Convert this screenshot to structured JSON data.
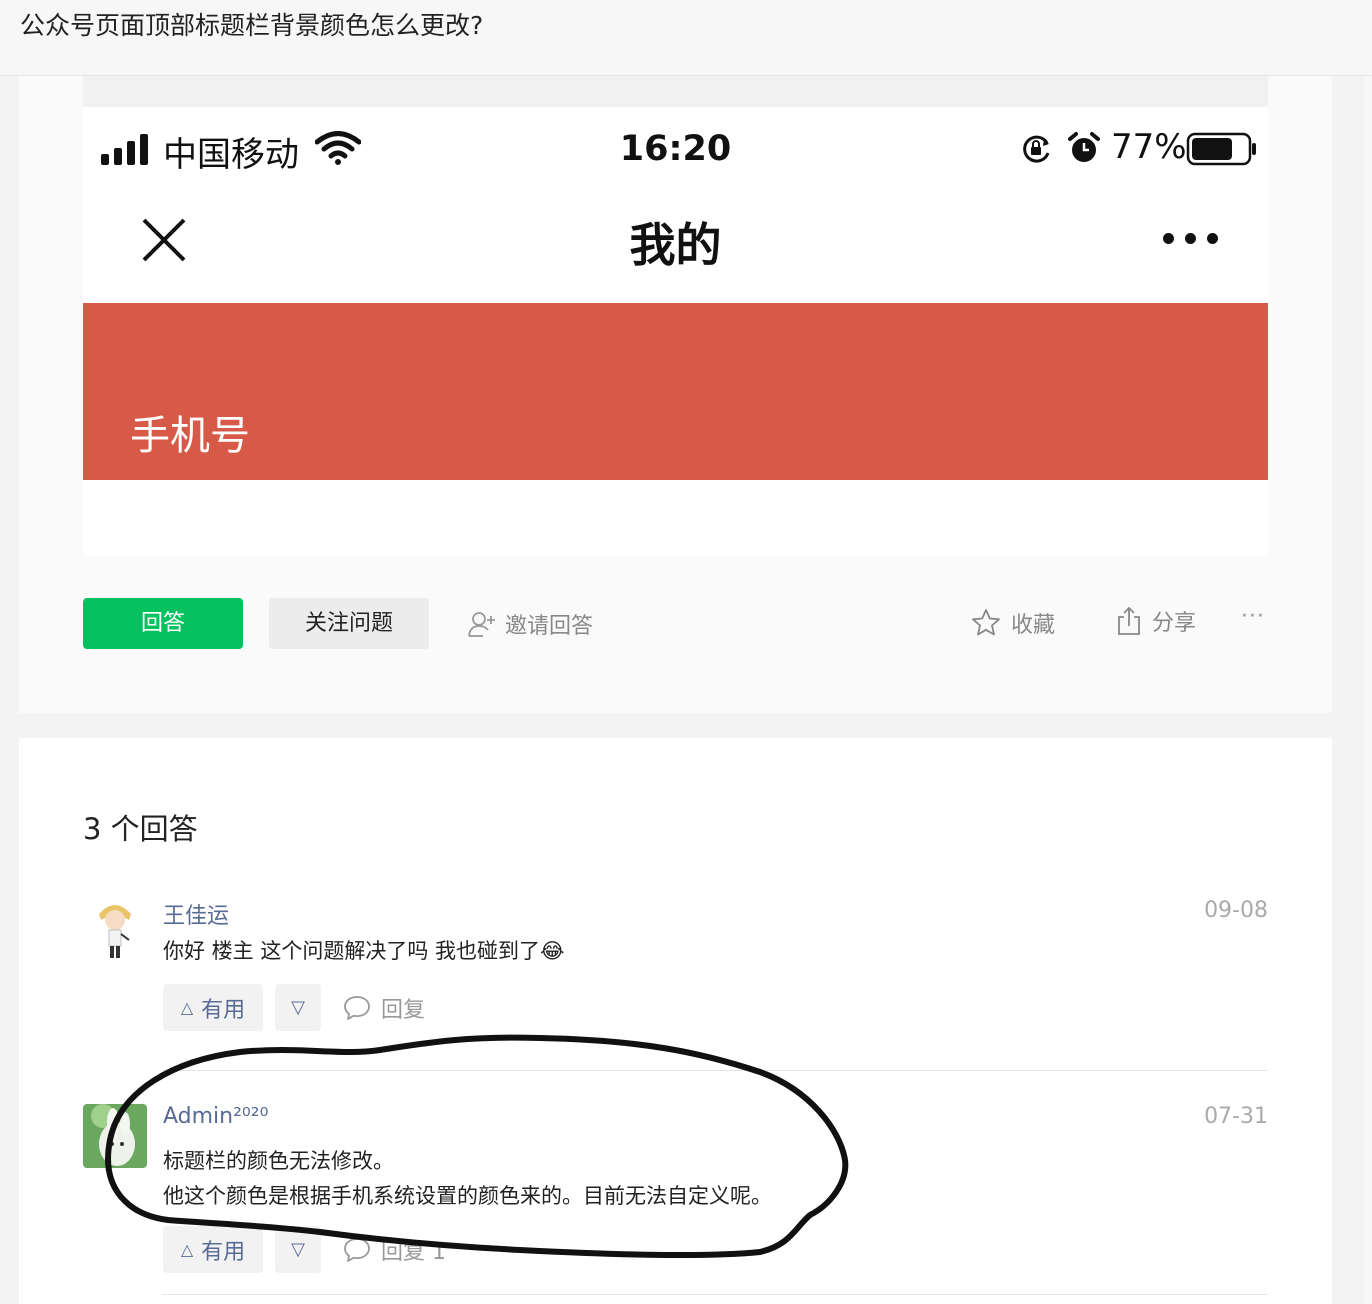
{
  "page": {
    "title": "公众号页面顶部标题栏背景颜色怎么更改?"
  },
  "phone": {
    "carrier": "中国移动",
    "time": "16:20",
    "battery": "77%",
    "nav_title": "我的",
    "banner_text": "手机号",
    "banner_color": "#d65a47"
  },
  "actions": {
    "answer": "回答",
    "follow": "关注问题",
    "invite": "邀请回答",
    "collect": "收藏",
    "share": "分享",
    "more": "···"
  },
  "answers": {
    "count_label": "3 个回答",
    "items": [
      {
        "author": "王佳运",
        "date": "09-08",
        "lines": [
          "你好 楼主 这个问题解决了吗 我也碰到了😂"
        ],
        "useful": "有用",
        "reply": "回复"
      },
      {
        "author": "Admin²⁰²⁰",
        "date": "07-31",
        "lines": [
          "标题栏的颜色无法修改。",
          "他这个颜色是根据手机系统设置的颜色来的。目前无法自定义呢。"
        ],
        "useful": "有用",
        "reply": "回复 1"
      }
    ]
  },
  "colors": {
    "accent_green": "#07c160",
    "link_blue": "#576b95"
  }
}
